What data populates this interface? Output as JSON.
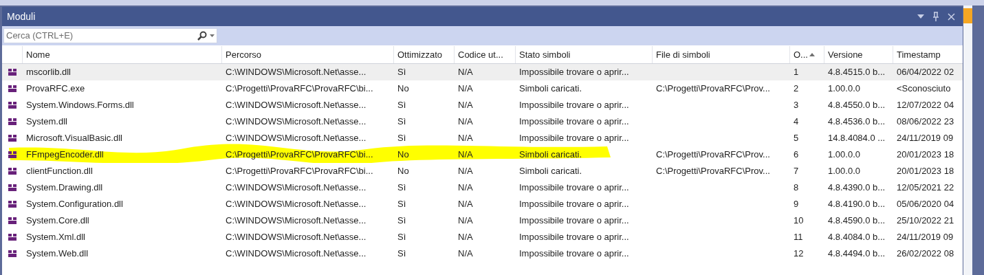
{
  "window": {
    "title": "Moduli"
  },
  "search": {
    "placeholder": "Cerca (CTRL+E)"
  },
  "table": {
    "columns": [
      {
        "label": "Nome",
        "sorted": false
      },
      {
        "label": "Percorso",
        "sorted": false
      },
      {
        "label": "Ottimizzato",
        "sorted": false
      },
      {
        "label": "Codice ut...",
        "sorted": false
      },
      {
        "label": "Stato simboli",
        "sorted": false
      },
      {
        "label": "File di simboli",
        "sorted": false
      },
      {
        "label": "O...",
        "sorted": true
      },
      {
        "label": "Versione",
        "sorted": false
      },
      {
        "label": "Timestamp",
        "sorted": false
      }
    ],
    "rows": [
      {
        "selected": true,
        "highlighted": false,
        "cells": [
          "mscorlib.dll",
          "C:\\WINDOWS\\Microsoft.Net\\asse...",
          "Sì",
          "N/A",
          "Impossibile trovare o aprir...",
          "",
          "1",
          "4.8.4515.0 b...",
          "06/04/2022 02"
        ]
      },
      {
        "selected": false,
        "highlighted": false,
        "cells": [
          "ProvaRFC.exe",
          "C:\\Progetti\\ProvaRFC\\ProvaRFC\\bi...",
          "No",
          "N/A",
          "Simboli caricati.",
          "C:\\Progetti\\ProvaRFC\\Prov...",
          "2",
          "1.00.0.0",
          "<Sconosciuto"
        ]
      },
      {
        "selected": false,
        "highlighted": false,
        "cells": [
          "System.Windows.Forms.dll",
          "C:\\WINDOWS\\Microsoft.Net\\asse...",
          "Sì",
          "N/A",
          "Impossibile trovare o aprir...",
          "",
          "3",
          "4.8.4550.0 b...",
          "12/07/2022 04"
        ]
      },
      {
        "selected": false,
        "highlighted": false,
        "cells": [
          "System.dll",
          "C:\\WINDOWS\\Microsoft.Net\\asse...",
          "Sì",
          "N/A",
          "Impossibile trovare o aprir...",
          "",
          "4",
          "4.8.4536.0 b...",
          "08/06/2022 23"
        ]
      },
      {
        "selected": false,
        "highlighted": false,
        "cells": [
          "Microsoft.VisualBasic.dll",
          "C:\\WINDOWS\\Microsoft.Net\\asse...",
          "Sì",
          "N/A",
          "Impossibile trovare o aprir...",
          "",
          "5",
          "14.8.4084.0 ...",
          "24/11/2019 09"
        ]
      },
      {
        "selected": false,
        "highlighted": true,
        "cells": [
          "FFmpegEncoder.dll",
          "C:\\Progetti\\ProvaRFC\\ProvaRFC\\bi...",
          "No",
          "N/A",
          "Simboli caricati.",
          "C:\\Progetti\\ProvaRFC\\Prov...",
          "6",
          "1.00.0.0",
          "20/01/2023 18"
        ]
      },
      {
        "selected": false,
        "highlighted": false,
        "cells": [
          "clientFunction.dll",
          "C:\\Progetti\\ProvaRFC\\ProvaRFC\\bi...",
          "No",
          "N/A",
          "Simboli caricati.",
          "C:\\Progetti\\ProvaRFC\\Prov...",
          "7",
          "1.00.0.0",
          "20/01/2023 18"
        ]
      },
      {
        "selected": false,
        "highlighted": false,
        "cells": [
          "System.Drawing.dll",
          "C:\\WINDOWS\\Microsoft.Net\\asse...",
          "Sì",
          "N/A",
          "Impossibile trovare o aprir...",
          "",
          "8",
          "4.8.4390.0 b...",
          "12/05/2021 22"
        ]
      },
      {
        "selected": false,
        "highlighted": false,
        "cells": [
          "System.Configuration.dll",
          "C:\\WINDOWS\\Microsoft.Net\\asse...",
          "Sì",
          "N/A",
          "Impossibile trovare o aprir...",
          "",
          "9",
          "4.8.4190.0 b...",
          "05/06/2020 04"
        ]
      },
      {
        "selected": false,
        "highlighted": false,
        "cells": [
          "System.Core.dll",
          "C:\\WINDOWS\\Microsoft.Net\\asse...",
          "Sì",
          "N/A",
          "Impossibile trovare o aprir...",
          "",
          "10",
          "4.8.4590.0 b...",
          "25/10/2022 21"
        ]
      },
      {
        "selected": false,
        "highlighted": false,
        "cells": [
          "System.Xml.dll",
          "C:\\WINDOWS\\Microsoft.Net\\asse...",
          "Sì",
          "N/A",
          "Impossibile trovare o aprir...",
          "",
          "11",
          "4.8.4084.0 b...",
          "24/11/2019 09"
        ]
      },
      {
        "selected": false,
        "highlighted": false,
        "cells": [
          "System.Web.dll",
          "C:\\WINDOWS\\Microsoft.Net\\asse...",
          "Sì",
          "N/A",
          "Impossibile trovare o aprir...",
          "",
          "12",
          "4.8.4494.0 b...",
          "26/02/2022 08"
        ]
      }
    ]
  }
}
